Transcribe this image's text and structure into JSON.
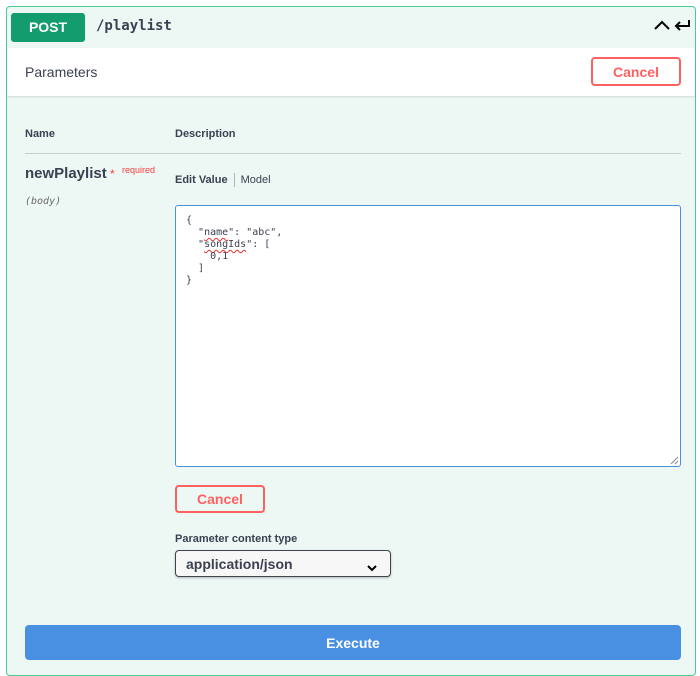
{
  "operation": {
    "method": "POST",
    "path": "/playlist",
    "collapse_icon": "chevron-up-icon",
    "try_icon": "return-arrow-icon"
  },
  "parameters": {
    "title": "Parameters",
    "cancel_label": "Cancel",
    "columns": {
      "name": "Name",
      "description": "Description"
    }
  },
  "param": {
    "name": "newPlaylist",
    "required_star": "*",
    "required_text": "required",
    "in": "(body)",
    "tabs": {
      "edit_value": "Edit Value",
      "model": "Model"
    },
    "body_lines": [
      {
        "pre": "{",
        "key": "",
        "post": ""
      },
      {
        "pre": "  \"",
        "key": "name",
        "post": "\": \"abc\","
      },
      {
        "pre": "  \"",
        "key": "songIds",
        "post": "\": ["
      },
      {
        "pre": "    0,1",
        "key": "",
        "post": ""
      },
      {
        "pre": "  ]",
        "key": "",
        "post": ""
      },
      {
        "pre": "}",
        "key": "",
        "post": ""
      }
    ],
    "cancel_label": "Cancel",
    "content_type_label": "Parameter content type",
    "content_type_value": "application/json"
  },
  "execute_label": "Execute",
  "colors": {
    "post_badge": "#139c6e",
    "border_green": "#49cc90",
    "panel_bg": "#edf7f4",
    "cancel_red": "#ff6060",
    "execute_blue": "#4990e2"
  }
}
